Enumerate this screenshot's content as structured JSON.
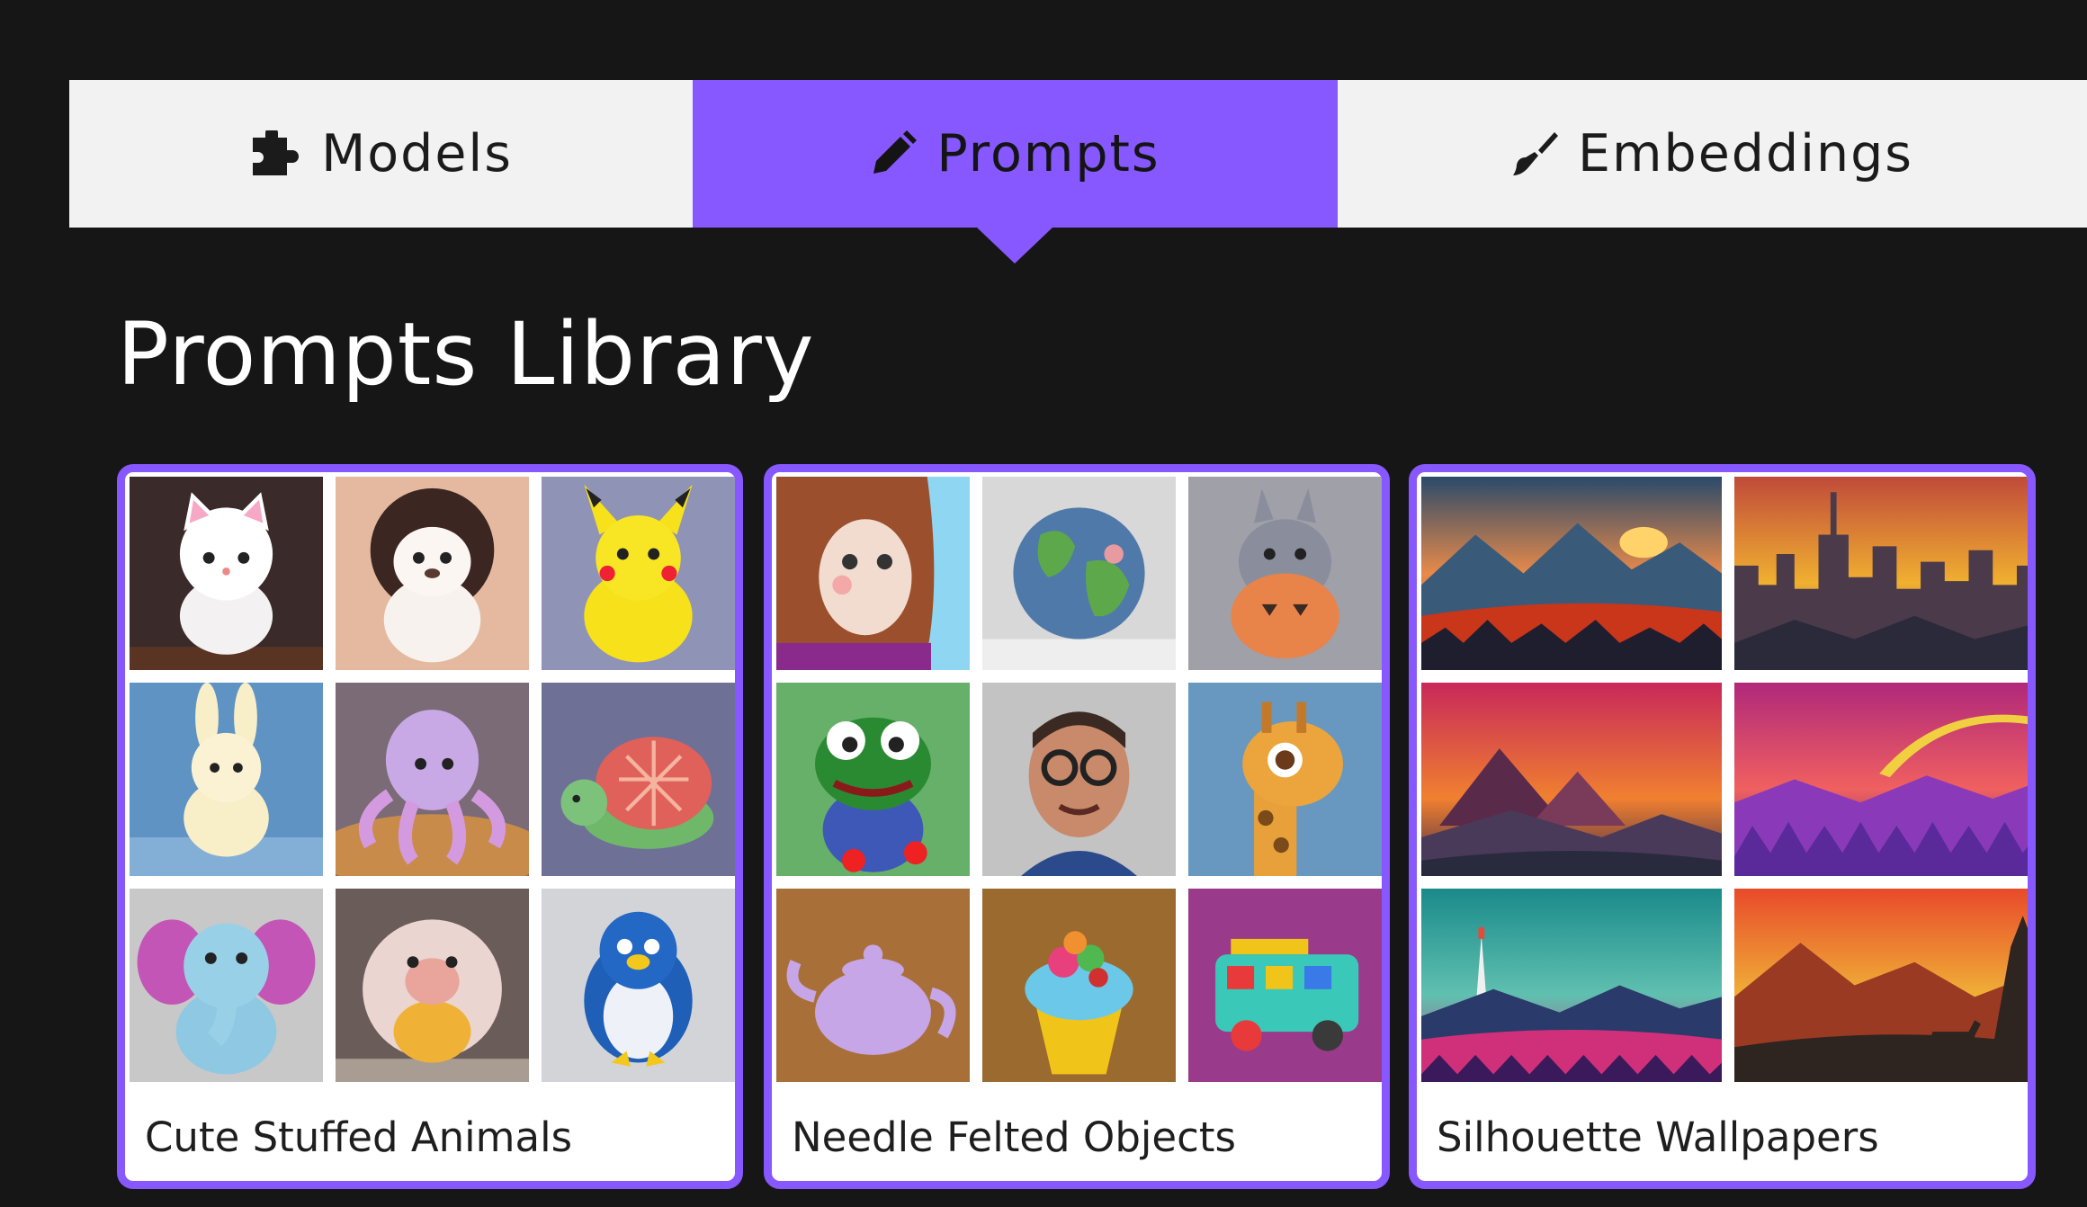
{
  "tabs": [
    {
      "label": "Models",
      "icon": "puzzle-icon",
      "active": false
    },
    {
      "label": "Prompts",
      "icon": "pencil-icon",
      "active": true
    },
    {
      "label": "Embeddings",
      "icon": "brush-icon",
      "active": false
    }
  ],
  "page": {
    "title": "Prompts Library"
  },
  "colors": {
    "accent": "#8757ff",
    "background": "#161616",
    "tab_bg": "#f2f2f2"
  },
  "cards": [
    {
      "title": "Cute Stuffed Animals",
      "images": [
        "kitten-plush",
        "lion-plush",
        "pikachu-plush",
        "bunny-plush",
        "octopus-plush",
        "turtle-plush",
        "elephant-plush",
        "hedgehog-plush",
        "penguin-plush"
      ]
    },
    {
      "title": "Needle Felted Objects",
      "images": [
        "felted-girl",
        "felted-globe",
        "felted-totoro",
        "felted-frog",
        "felted-man-glasses",
        "felted-giraffe",
        "felted-teapot",
        "felted-cupcake",
        "felted-bus"
      ]
    },
    {
      "title": "Silhouette Wallpapers",
      "images": [
        "mountain-sunset",
        "city-skyline",
        "pyramid-dusk",
        "rainbow-forest",
        "rocket-launch",
        "deer-sunset"
      ]
    }
  ]
}
